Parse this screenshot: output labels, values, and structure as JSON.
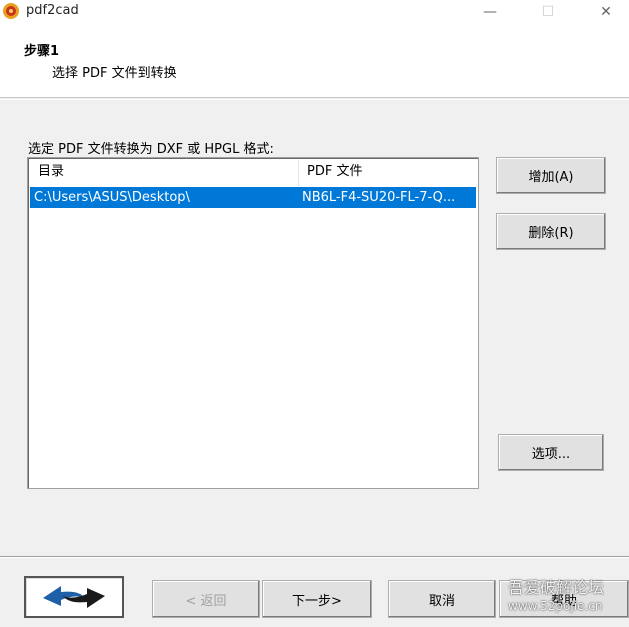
{
  "window": {
    "title": "pdf2cad",
    "minimize": "—",
    "maximize": "☐",
    "close": "✕"
  },
  "header": {
    "step_title": "步骤1",
    "step_subtitle": "选择 PDF 文件到转换"
  },
  "file_list": {
    "label": "选定 PDF 文件转换为 DXF 或 HPGL 格式:",
    "columns": [
      "目录",
      "PDF 文件"
    ],
    "rows": [
      {
        "directory": "C:\\Users\\ASUS\\Desktop\\",
        "file": "NB6L-F4-SU20-FL-7-Q...",
        "selected": true
      }
    ]
  },
  "side_buttons": {
    "add": "增加(A)",
    "delete": "删除(R)",
    "options": "选项..."
  },
  "footer": {
    "logo_icon": "pdf2cad-logo-icon",
    "back": "< 返回",
    "next": "下一步>",
    "cancel": "取消",
    "help": "帮助"
  },
  "watermark": {
    "line1": "吾爱破解论坛",
    "line2": "www.52pojie.cn"
  },
  "colors": {
    "selection": "#0078d7",
    "background": "#f0f0f0",
    "logo_blue": "#1f5fa8",
    "logo_dark": "#1a1a1a"
  }
}
